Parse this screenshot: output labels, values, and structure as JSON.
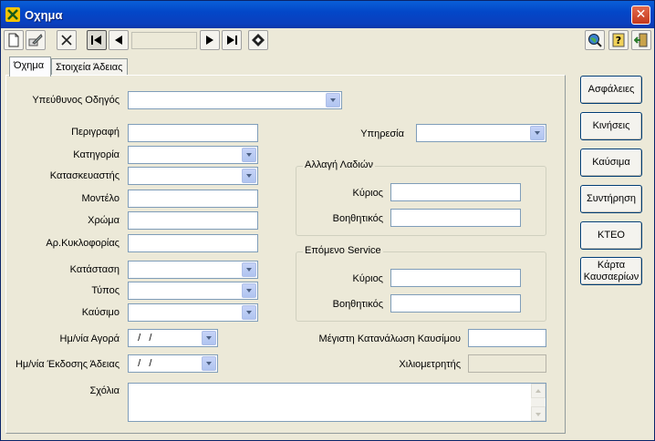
{
  "window": {
    "title": "Οχημα",
    "close_glyph": "✕"
  },
  "toolbar": {
    "icons": [
      "new-document-icon",
      "edit-icon",
      "delete-icon",
      "first-record-icon",
      "previous-record-icon",
      "next-record-icon",
      "last-record-icon",
      "bookmark-icon",
      "search-globe-icon",
      "help-icon",
      "exit-door-icon"
    ],
    "record_position": ""
  },
  "tabs": [
    {
      "label": "Όχημα",
      "active": true
    },
    {
      "label": "Στοιχεία Άδειας",
      "active": false
    }
  ],
  "form": {
    "driver": {
      "label": "Υπεύθυνος Οδηγός",
      "value": ""
    },
    "description": {
      "label": "Περιγραφή",
      "value": ""
    },
    "category": {
      "label": "Κατηγορία",
      "value": ""
    },
    "manufacturer": {
      "label": "Κατασκευαστής",
      "value": ""
    },
    "model": {
      "label": "Μοντέλο",
      "value": ""
    },
    "color": {
      "label": "Χρώμα",
      "value": ""
    },
    "plate": {
      "label": "Αρ.Κυκλοφορίας",
      "value": ""
    },
    "status": {
      "label": "Κατάσταση",
      "value": ""
    },
    "type": {
      "label": "Τύπος",
      "value": ""
    },
    "fuel": {
      "label": "Καύσιμο",
      "value": ""
    },
    "purchase_date": {
      "label": "Ημ/νία Αγορά",
      "value": "  /   /"
    },
    "license_date": {
      "label": "Ημ/νία Έκδοσης Άδειας",
      "value": "  /   /"
    },
    "comments": {
      "label": "Σχόλια",
      "value": ""
    },
    "service": {
      "label": "Υπηρεσία",
      "value": ""
    },
    "oil_change": {
      "title": "Αλλαγή Λαδιών",
      "main": {
        "label": "Κύριος",
        "value": ""
      },
      "aux": {
        "label": "Βοηθητικός",
        "value": ""
      }
    },
    "next_service": {
      "title": "Επόμενο Service",
      "main": {
        "label": "Κύριος",
        "value": ""
      },
      "aux": {
        "label": "Βοηθητικός",
        "value": ""
      }
    },
    "max_fuel": {
      "label": "Μέγιστη Κατανάλωση Καυσίμου",
      "value": ""
    },
    "odometer": {
      "label": "Χιλιομετρητής",
      "value": ""
    }
  },
  "side_buttons": [
    {
      "label": "Ασφάλειες"
    },
    {
      "label": "Κινήσεις"
    },
    {
      "label": "Καύσιμα"
    },
    {
      "label": "Συντήρηση"
    },
    {
      "label": "ΚΤΕΟ"
    },
    {
      "label": "Κάρτα Καυσαερίων"
    }
  ],
  "colors": {
    "titlebar": "#0347c8",
    "window_bg": "#ece9d8",
    "field_border": "#7f9db9"
  }
}
